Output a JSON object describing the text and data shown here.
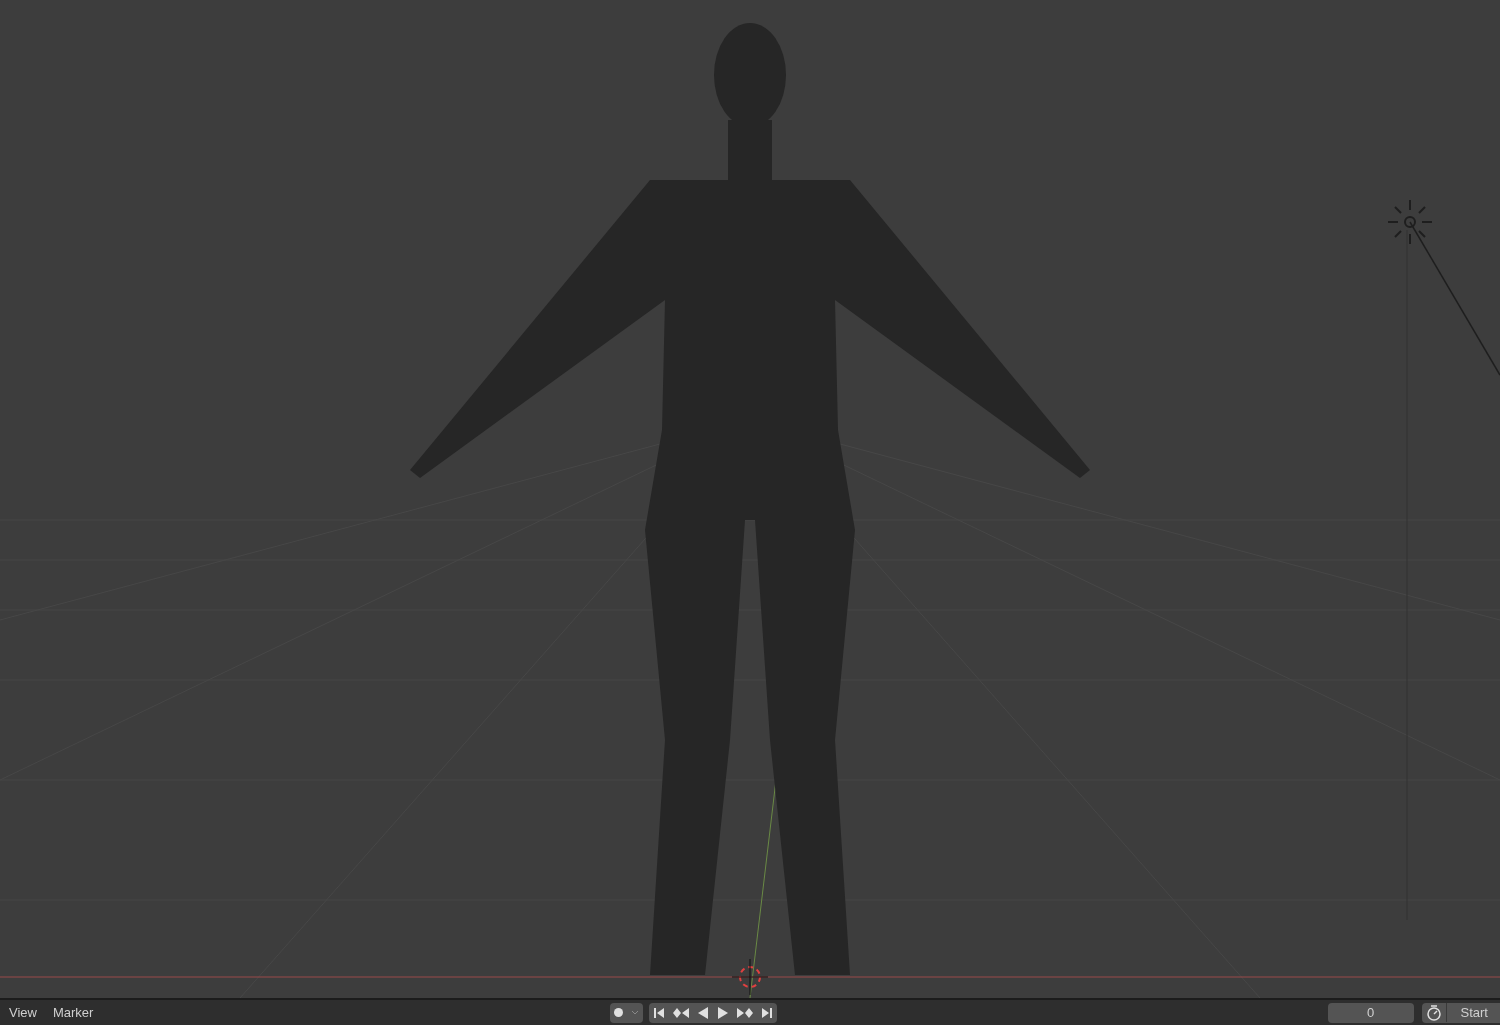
{
  "timeline": {
    "menus": [
      "View",
      "Marker"
    ],
    "current_frame": "0",
    "start_label": "Start"
  }
}
